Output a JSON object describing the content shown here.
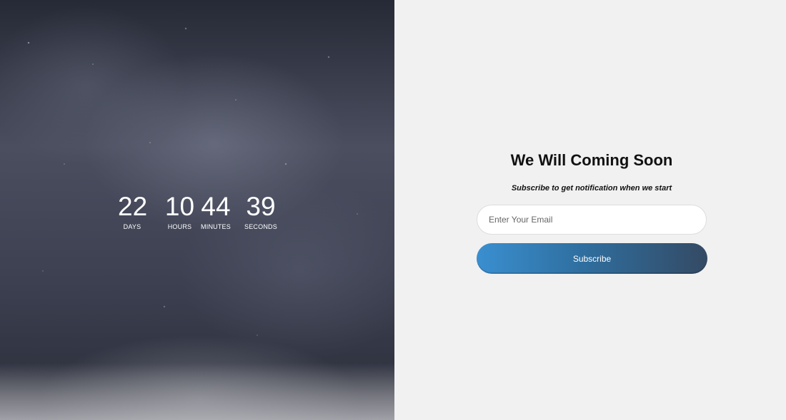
{
  "countdown": {
    "days": {
      "value": "22",
      "label": "DAYS"
    },
    "hours": {
      "value": "10",
      "label": "HOURS"
    },
    "minutes": {
      "value": "44",
      "label": "MINUTES"
    },
    "seconds": {
      "value": "39",
      "label": "SECONDS"
    }
  },
  "headline": "We Will Coming Soon",
  "subheadline": "Subscribe to get notification when we start",
  "email": {
    "placeholder": "Enter Your Email",
    "value": ""
  },
  "subscribe_button": "Subscribe",
  "colors": {
    "button_gradient_start": "#3a8fd0",
    "button_gradient_end": "#344a64",
    "right_background": "#f1f1f1"
  }
}
